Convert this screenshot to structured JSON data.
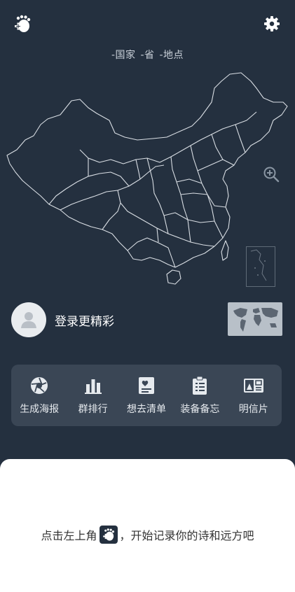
{
  "header": {
    "location": {
      "country": "-国家",
      "province": "-省",
      "place": "-地点"
    }
  },
  "user": {
    "login_prompt": "登录更精彩"
  },
  "actions": [
    {
      "label": "生成海报",
      "icon": "aperture-icon"
    },
    {
      "label": "群排行",
      "icon": "bar-chart-icon"
    },
    {
      "label": "想去清单",
      "icon": "wishlist-icon"
    },
    {
      "label": "装备备忘",
      "icon": "checklist-icon"
    },
    {
      "label": "明信片",
      "icon": "postcard-icon"
    }
  ],
  "hint": {
    "before": "点击左上角",
    "after": "，开始记录你的诗和远方吧"
  },
  "colors": {
    "background": "#24303f",
    "card": "#3a4655",
    "map_stroke": "#d9dee4"
  }
}
